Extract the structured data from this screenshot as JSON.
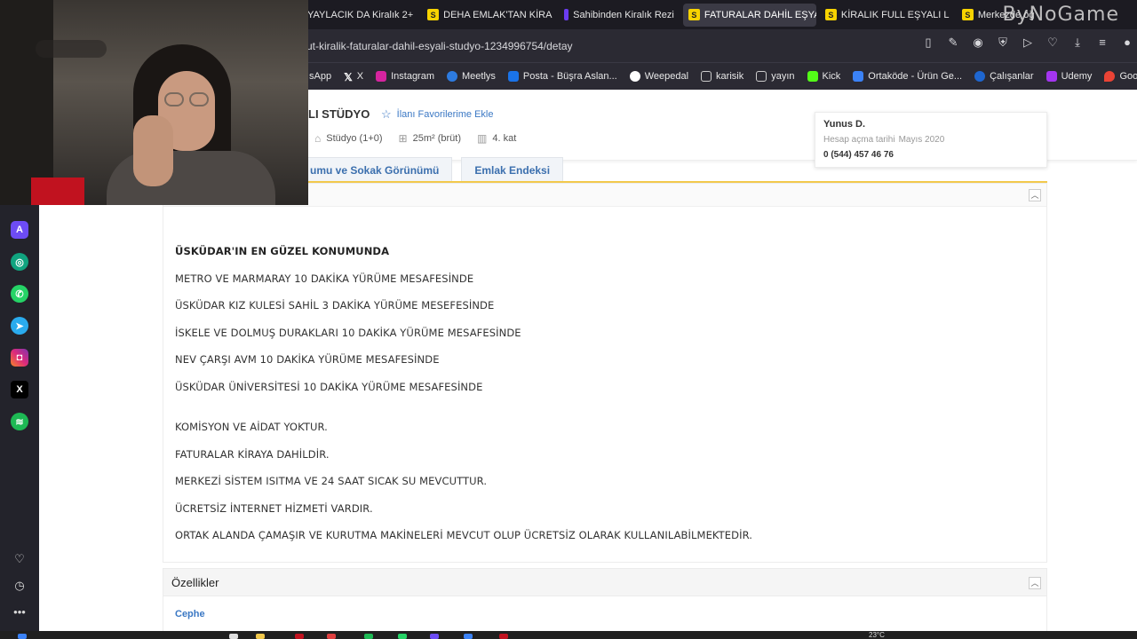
{
  "browser": {
    "tabs": [
      {
        "label": "YAYLACIK DA Kiralık 2+",
        "favicon": "none",
        "active": false
      },
      {
        "label": "DEHA EMLAK'TAN KİRA",
        "favicon": "S",
        "active": false
      },
      {
        "label": "Sahibinden Kiralık Rezi",
        "favicon": "bar",
        "active": false
      },
      {
        "label": "FATURALAR DAHİL EŞYALI",
        "favicon": "S",
        "active": true
      },
      {
        "label": "KİRALIK FULL EŞYALI L",
        "favicon": "S",
        "active": false
      },
      {
        "label": "Merkezde öğ",
        "favicon": "S",
        "active": false
      }
    ],
    "watermark": "ByNoGame",
    "url": "ut-kiralik-faturalar-dahil-esyali-studyo-1234996754/detay",
    "url_actions": [
      "reader-icon",
      "edit-icon",
      "camera-icon",
      "shield-icon",
      "play-icon",
      "heart-icon",
      "download-icon",
      "menu-icon",
      "profile-icon"
    ],
    "bookmarks": [
      {
        "label": "sApp",
        "color": "#2aa54a"
      },
      {
        "label": "X",
        "color": "#ffffff"
      },
      {
        "label": "Instagram",
        "color": "#d6249f"
      },
      {
        "label": "Meetlys",
        "color": "#2d7be0"
      },
      {
        "label": "Posta - Büşra Aslan...",
        "color": "#1a73e8"
      },
      {
        "label": "Weepedal",
        "color": "#ffffff"
      },
      {
        "label": "karisik",
        "color": "#cccccc"
      },
      {
        "label": "yayın",
        "color": "#cccccc"
      },
      {
        "label": "Kick",
        "color": "#53fc18"
      },
      {
        "label": "Ortaköde - Ürün Ge...",
        "color": "#3b82f6"
      },
      {
        "label": "Çalışanlar",
        "color": "#1e66d0"
      },
      {
        "label": "Udemy",
        "color": "#a435f0"
      },
      {
        "label": "Google Haritalar",
        "color": "#ea4335"
      }
    ]
  },
  "listing": {
    "title": "LI STÜDYO",
    "favorite_label": "İlanı Favorilerime Ekle",
    "specs": [
      {
        "icon": "room-icon",
        "label": "Stüdyo (1+0)"
      },
      {
        "icon": "area-icon",
        "label": "25m² (brüt)"
      },
      {
        "icon": "floor-icon",
        "label": "4. kat"
      }
    ]
  },
  "seller": {
    "name": "Yunus D.",
    "since_label": "Hesap açma tarihi",
    "since_value": "Mayıs 2020",
    "phone": "0 (544) 457 46 76"
  },
  "page_tabs": [
    "umu ve Sokak Görünümü",
    "Emlak Endeksi"
  ],
  "description": {
    "heading": "ÜSKÜDAR'IN EN GÜZEL KONUMUNDA",
    "group1": [
      "METRO VE MARMARAY 10 DAKİKA YÜRÜME MESAFESİNDE",
      "ÜSKÜDAR KIZ KULESİ SAHİL 3 DAKİKA YÜRÜME MESEFESİNDE",
      "İSKELE VE DOLMUŞ DURAKLARI 10 DAKİKA YÜRÜME MESAFESİNDE",
      "NEV ÇARŞI AVM 10 DAKİKA YÜRÜME MESAFESİNDE",
      "ÜSKÜDAR ÜNİVERSİTESİ 10 DAKİKA YÜRÜME MESAFESİNDE"
    ],
    "group2": [
      "KOMİSYON VE AİDAT YOKTUR.",
      "FATURALAR KİRAYA DAHİLDİR.",
      "MERKEZİ SİSTEM ISITMA VE 24 SAAT SICAK SU MEVCUTTUR.",
      "ÜCRETSİZ İNTERNET HİZMETİ VARDIR.",
      "ORTAK ALANDA ÇAMAŞIR VE KURUTMA MAKİNELERİ MEVCUT OLUP ÜCRETSİZ OLARAK KULLANILABİLMEKTEDİR."
    ]
  },
  "features": {
    "title": "Özellikler",
    "first_item": "Cephe"
  },
  "taskbar": {
    "temperature": "23°C"
  }
}
